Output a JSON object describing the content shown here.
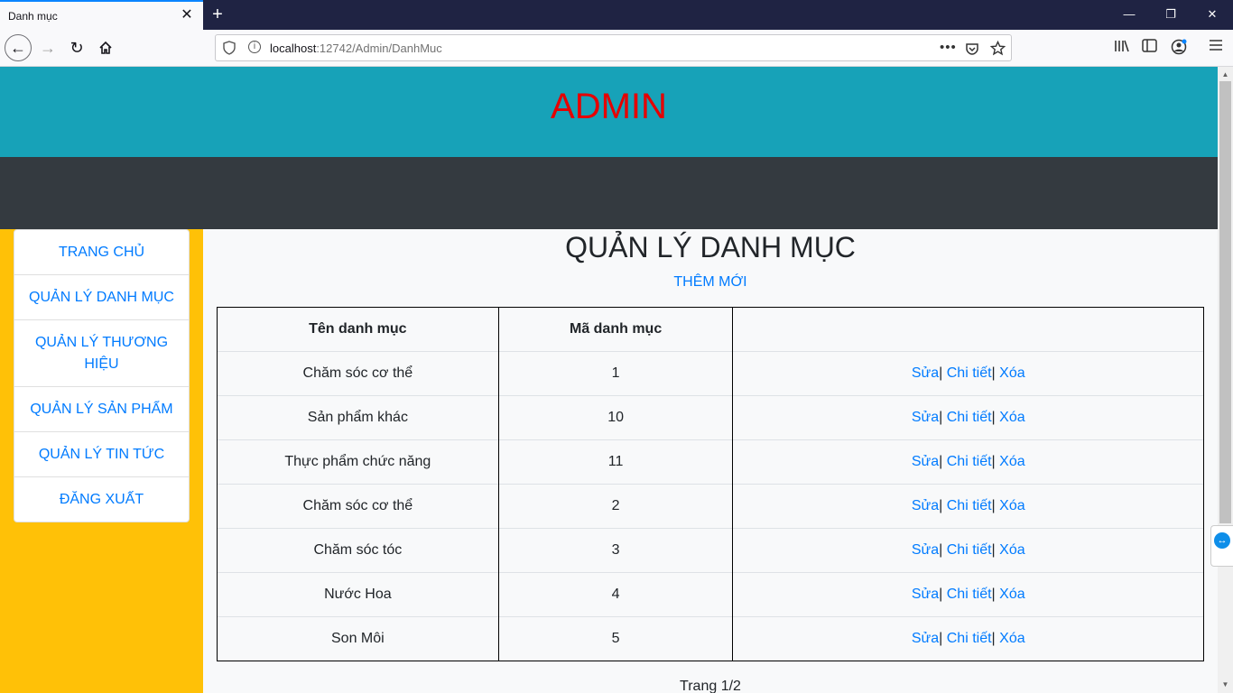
{
  "browser": {
    "tab_title": "Danh mục",
    "tab_close_icon": "close-icon",
    "new_tab": "+",
    "url_host": "localhost",
    "url_rest": ":12742/Admin/DanhMuc",
    "url_more": "•••",
    "window_controls": [
      "—",
      "❐",
      "✕"
    ]
  },
  "header": {
    "title": "ADMIN",
    "title_color": "#e60000",
    "background": "#17a2b8"
  },
  "sidebar": {
    "items": [
      {
        "label": "TRANG CHỦ"
      },
      {
        "label": "QUẢN LÝ DANH MỤC"
      },
      {
        "label": "QUẢN LÝ THƯƠNG HIỆU"
      },
      {
        "label": "QUẢN LÝ SẢN PHẨM"
      },
      {
        "label": "QUẢN LÝ TIN TỨC"
      },
      {
        "label": "ĐĂNG XUẤT"
      }
    ],
    "background": "#ffc107"
  },
  "main": {
    "title": "QUẢN LÝ DANH MỤC",
    "add_label": "THÊM MỚI",
    "table": {
      "headers": [
        "Tên danh mục",
        "Mã danh mục",
        ""
      ],
      "rows": [
        {
          "name": "Chăm sóc cơ thể",
          "code": "1"
        },
        {
          "name": "Sản phẩm khác",
          "code": "10"
        },
        {
          "name": "Thực phẩm chức năng",
          "code": "11"
        },
        {
          "name": "Chăm sóc cơ thể",
          "code": "2"
        },
        {
          "name": "Chăm sóc tóc",
          "code": "3"
        },
        {
          "name": "Nước Hoa",
          "code": "4"
        },
        {
          "name": "Son Môi",
          "code": "5"
        }
      ],
      "actions": {
        "edit": "Sửa",
        "detail": "Chi tiết",
        "delete": "Xóa",
        "separator": "|"
      }
    },
    "pager": "Trang 1/2"
  }
}
